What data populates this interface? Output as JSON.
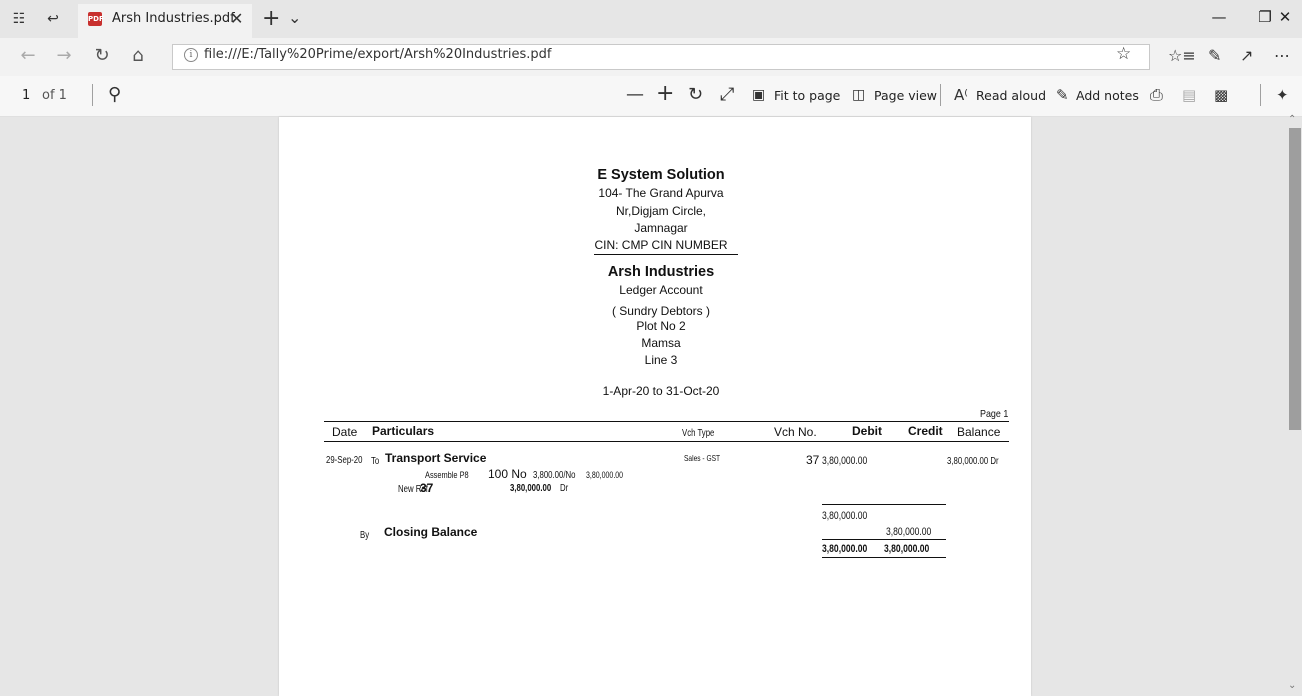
{
  "browser": {
    "tab_title": "Arsh Industries.pdf",
    "tab_icon_text": "PDF",
    "url": "file:///E:/Tally%20Prime/export/Arsh%20Industries.pdf"
  },
  "pdf_toolbar": {
    "page_number": "1",
    "page_of": "of 1",
    "fit_to_page": "Fit to page",
    "page_view": "Page view",
    "read_aloud": "Read aloud",
    "add_notes": "Add notes"
  },
  "document": {
    "company_name": "E System Solution",
    "address_line1": "104- The Grand Apurva",
    "address_line2": "Nr,Digjam Circle,",
    "address_line3": "Jamnagar",
    "cin": "CIN: CMP CIN NUMBER",
    "party_name": "Arsh Industries",
    "report_name": "Ledger Account",
    "group": "( Sundry Debtors )",
    "party_addr1": "Plot No 2",
    "party_addr2": "Mamsa",
    "party_addr3": "Line 3",
    "period": "1-Apr-20 to 31-Oct-20",
    "page_label": "Page 1",
    "headers": {
      "date": "Date",
      "particulars": "Particulars",
      "vch_type": "Vch Type",
      "vch_no": "Vch No.",
      "debit": "Debit",
      "credit": "Credit",
      "balance": "Balance"
    },
    "entry": {
      "date": "29-Sep-20",
      "to_by": "To",
      "particulars": "Transport Service",
      "vch_type": "Sales - GST",
      "vch_no": "37",
      "debit": "3,80,000.00",
      "balance": "3,80,000.00 Dr",
      "item_name": "Assemble P8",
      "item_qty": "100 No",
      "item_rate": "3,800.00/No",
      "item_amount": "3,80,000.00",
      "ref_type": "New Ref",
      "ref_no": "37",
      "ref_amount": "3,80,000.00",
      "ref_drcr": "Dr"
    },
    "closing": {
      "subtotal_debit": "3,80,000.00",
      "by": "By",
      "label": "Closing Balance",
      "credit": "3,80,000.00",
      "total_debit": "3,80,000.00",
      "total_credit": "3,80,000.00"
    }
  }
}
